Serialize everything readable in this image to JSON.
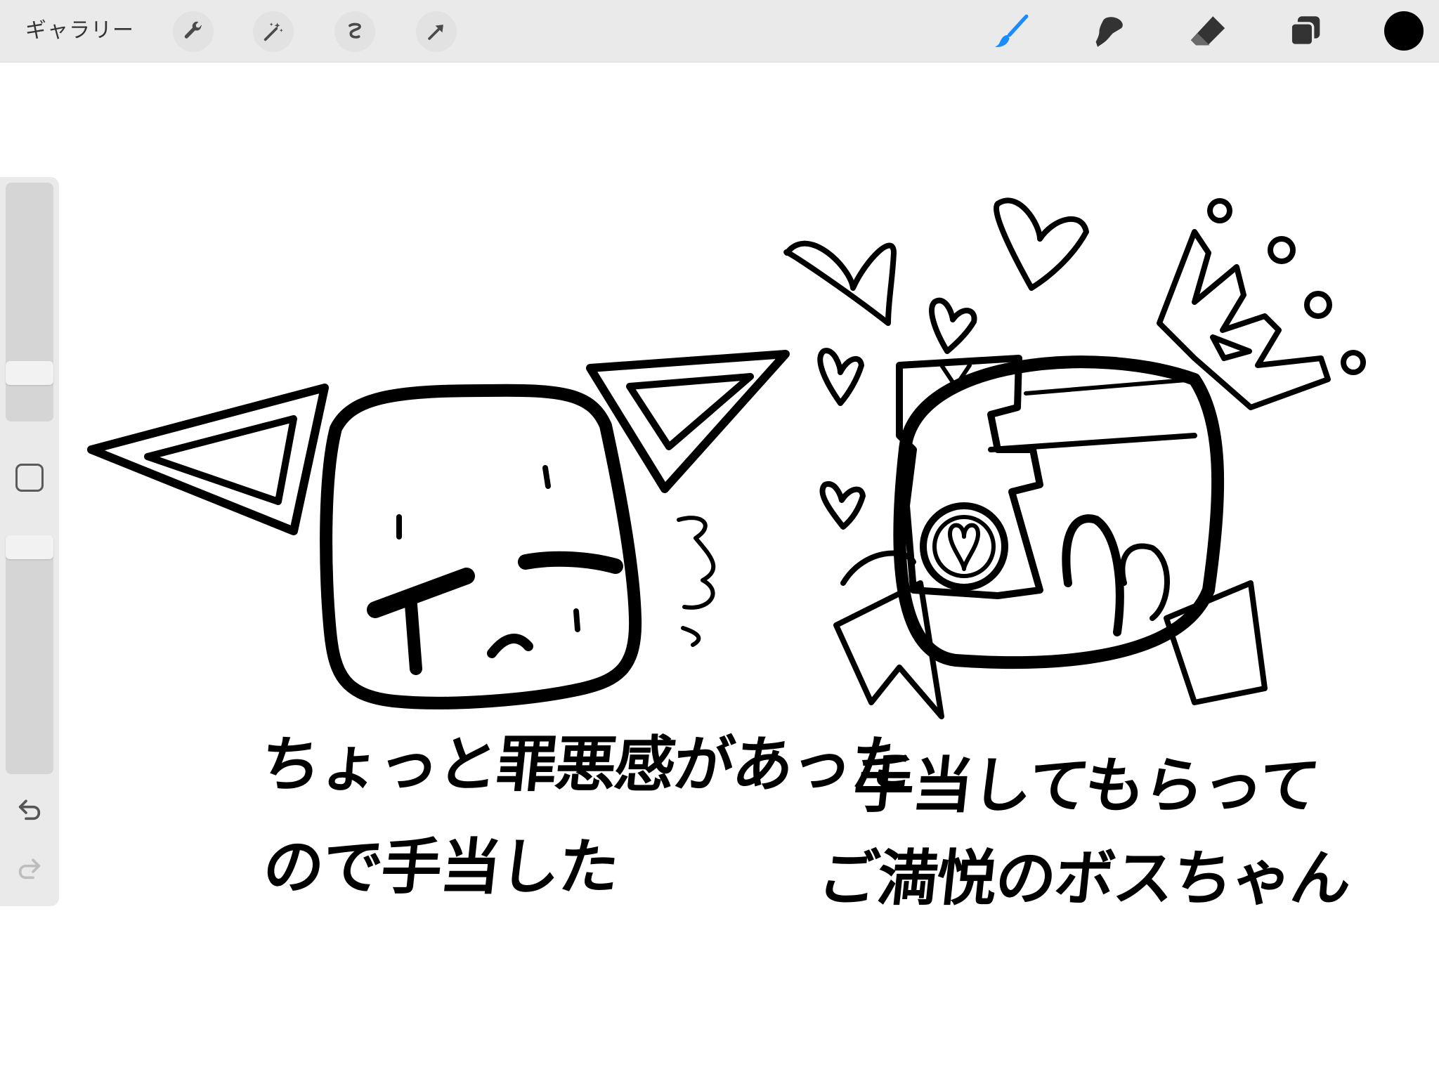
{
  "toolbar": {
    "gallery_label": "ギャラリー",
    "left_tools": [
      {
        "icon": "wrench-icon"
      },
      {
        "icon": "magic-wand-icon"
      },
      {
        "icon": "selection-icon"
      },
      {
        "icon": "transform-arrow-icon"
      }
    ],
    "right_tools": [
      {
        "icon": "brush-icon",
        "color": "#1a8cff"
      },
      {
        "icon": "smudge-icon",
        "color": "#333333"
      },
      {
        "icon": "eraser-icon",
        "color": "#333333"
      },
      {
        "icon": "layers-icon",
        "color": "#333333"
      }
    ],
    "current_color": "#000000"
  },
  "sidebar": {
    "undo_icon": "undo-icon",
    "redo_icon": "redo-icon",
    "modify_icon": "modify-square-icon"
  },
  "canvas": {
    "caption_left_line1": "ちょっと罪悪感があった",
    "caption_left_line2": "ので手当した",
    "caption_right_line1": "手当してもらって",
    "caption_right_line2": "ご満悦のボスちゃん"
  }
}
